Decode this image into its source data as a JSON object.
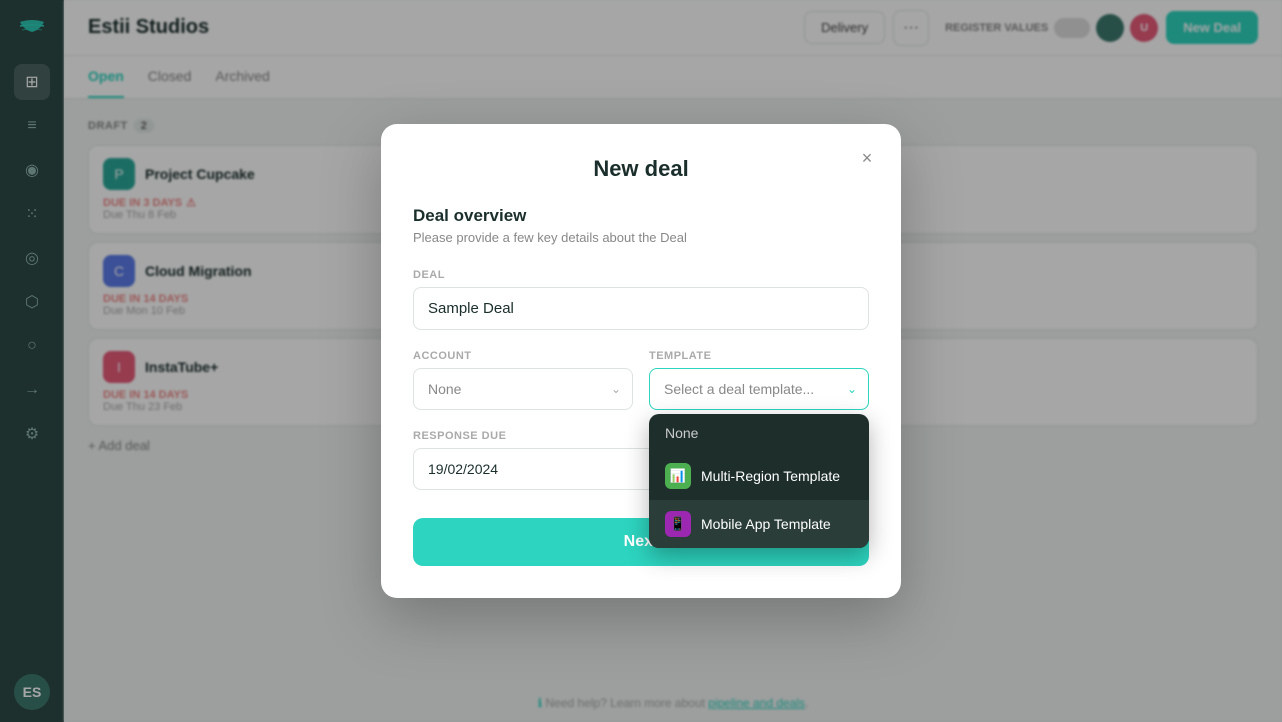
{
  "app": {
    "title": "Estii Studios",
    "new_deal_button": "New Deal",
    "tabs": [
      "Open",
      "Closed",
      "Archived"
    ],
    "active_tab": "Open",
    "topbar_buttons": [
      "Delivery",
      "···"
    ],
    "toggle_label": "REGISTER VALUES"
  },
  "board": {
    "draft_label": "DRAFT",
    "draft_count": "2",
    "deals": [
      {
        "name": "Project Cupcake",
        "due_label": "DUE IN 3 DAYS",
        "due_warning": "⚠",
        "sub": "Due Thu 8 Feb",
        "icon_color": "#2aa89a",
        "initial": "P"
      },
      {
        "name": "Cloud Migration",
        "due_label": "DUE IN 14 DAYS",
        "sub": "Due Mon 10 Feb",
        "icon_color": "#5b7be8",
        "initial": "C"
      },
      {
        "name": "InstaTube+",
        "due_label": "DUE IN 14 DAYS",
        "sub": "Due Thu 23 Feb",
        "icon_color": "#e85b7a",
        "initial": "I"
      }
    ],
    "add_deal_label": "+ Add deal",
    "help_text": "Need help? Learn more about pipeline and deals."
  },
  "modal": {
    "title": "New deal",
    "section_title": "Deal overview",
    "section_subtitle": "Please provide a few key details about the Deal",
    "deal_label": "DEAL",
    "deal_placeholder": "Sample Deal",
    "deal_value": "Sample Deal",
    "account_label": "ACCOUNT",
    "account_value": "None",
    "template_label": "TEMPLATE",
    "template_placeholder": "Select a deal template...",
    "response_due_label": "RESPONSE DUE",
    "response_due_value": "19/02/2024",
    "next_button": "Next",
    "close_icon": "×",
    "dropdown": {
      "items": [
        {
          "id": "none",
          "label": "None"
        },
        {
          "id": "multi-region",
          "label": "Multi-Region Template",
          "icon_color": "#4caf50",
          "icon": "📊"
        },
        {
          "id": "mobile-app",
          "label": "Mobile App Template",
          "icon_color": "#9c27b0",
          "icon": "📱",
          "highlighted": true
        }
      ]
    }
  },
  "sidebar": {
    "items": [
      {
        "icon": "grid",
        "label": "Dashboard"
      },
      {
        "icon": "bars",
        "label": "Menu"
      },
      {
        "icon": "person",
        "label": "Profile"
      },
      {
        "icon": "users",
        "label": "Team"
      },
      {
        "icon": "target",
        "label": "Goals"
      },
      {
        "icon": "tag",
        "label": "Tags"
      },
      {
        "icon": "circle",
        "label": "Status"
      },
      {
        "icon": "arrow",
        "label": "Pipeline"
      },
      {
        "icon": "settings",
        "label": "Settings"
      }
    ],
    "avatar_initials": "ES"
  },
  "colors": {
    "teal_accent": "#2dd4bf",
    "sidebar_bg": "#2d4a47",
    "dark_dropdown": "#1e2e2b"
  }
}
